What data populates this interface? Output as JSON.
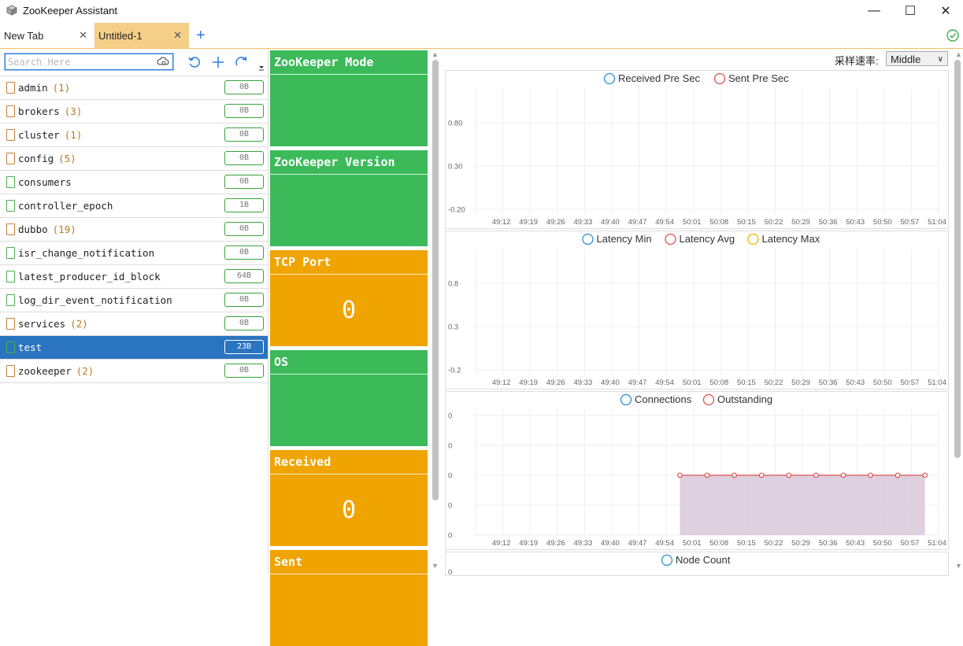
{
  "window": {
    "title": "ZooKeeper Assistant",
    "min": "—",
    "max": "☐",
    "close": "✕"
  },
  "tabs": [
    {
      "label": "New Tab",
      "close": "✕"
    },
    {
      "label": "Untitled-1",
      "close": "✕"
    }
  ],
  "tab_add": "+",
  "search": {
    "placeholder": "Search Here"
  },
  "nodes": [
    {
      "name": "admin",
      "count": "(1)",
      "size": "0B",
      "type": "folder"
    },
    {
      "name": "brokers",
      "count": "(3)",
      "size": "0B",
      "type": "folder"
    },
    {
      "name": "cluster",
      "count": "(1)",
      "size": "0B",
      "type": "folder"
    },
    {
      "name": "config",
      "count": "(5)",
      "size": "0B",
      "type": "folder"
    },
    {
      "name": "consumers",
      "count": "",
      "size": "0B",
      "type": "file"
    },
    {
      "name": "controller_epoch",
      "count": "",
      "size": "1B",
      "type": "file"
    },
    {
      "name": "dubbo",
      "count": "(19)",
      "size": "0B",
      "type": "folder"
    },
    {
      "name": "isr_change_notification",
      "count": "",
      "size": "0B",
      "type": "file"
    },
    {
      "name": "latest_producer_id_block",
      "count": "",
      "size": "64B",
      "type": "file"
    },
    {
      "name": "log_dir_event_notification",
      "count": "",
      "size": "0B",
      "type": "file"
    },
    {
      "name": "services",
      "count": "(2)",
      "size": "0B",
      "type": "folder"
    },
    {
      "name": "test",
      "count": "",
      "size": "23B",
      "type": "file",
      "selected": true
    },
    {
      "name": "zookeeper",
      "count": "(2)",
      "size": "0B",
      "type": "folder"
    }
  ],
  "cards": [
    {
      "title": "ZooKeeper Mode",
      "value": "",
      "color": "#3cba5a"
    },
    {
      "title": "ZooKeeper Version",
      "value": "",
      "color": "#3cba5a"
    },
    {
      "title": "TCP Port",
      "value": "0",
      "color": "#f0a400"
    },
    {
      "title": "OS",
      "value": "",
      "color": "#3cba5a"
    },
    {
      "title": "Received",
      "value": "0",
      "color": "#f0a400"
    },
    {
      "title": "Sent",
      "value": "",
      "color": "#f0a400"
    }
  ],
  "sample_rate": {
    "label": "采样速率:",
    "value": "Middle"
  },
  "chart_data": [
    {
      "type": "line",
      "series": [
        {
          "name": "Received Pre Sec",
          "color": "#2a8fd8",
          "values": []
        },
        {
          "name": "Sent Pre Sec",
          "color": "#e05050",
          "values": []
        }
      ],
      "x": [
        "49:12",
        "49:19",
        "49:26",
        "49:33",
        "49:40",
        "49:47",
        "49:54",
        "50:01",
        "50:08",
        "50:15",
        "50:22",
        "50:29",
        "50:36",
        "50:43",
        "50:50",
        "50:57",
        "51:04"
      ],
      "yticks": [
        "0.80",
        "0.30",
        "-0.20"
      ]
    },
    {
      "type": "line",
      "series": [
        {
          "name": "Latency Min",
          "color": "#2a8fd8",
          "values": []
        },
        {
          "name": "Latency Avg",
          "color": "#e05050",
          "values": []
        },
        {
          "name": "Latency Max",
          "color": "#f0b400",
          "values": []
        }
      ],
      "x": [
        "49:12",
        "49:19",
        "49:26",
        "49:33",
        "49:40",
        "49:47",
        "49:54",
        "50:01",
        "50:08",
        "50:15",
        "50:22",
        "50:29",
        "50:36",
        "50:43",
        "50:50",
        "50:57",
        "51:04"
      ],
      "yticks": [
        "0.8",
        "0.3",
        "-0.2"
      ]
    },
    {
      "type": "area",
      "series": [
        {
          "name": "Connections",
          "color": "#2a8fd8",
          "values": []
        },
        {
          "name": "Outstanding",
          "color": "#e05050",
          "values": [
            0,
            0,
            0,
            0,
            0,
            0,
            0,
            0,
            0,
            0
          ]
        }
      ],
      "x": [
        "49:12",
        "49:19",
        "49:26",
        "49:33",
        "49:40",
        "49:47",
        "49:54",
        "50:01",
        "50:08",
        "50:15",
        "50:22",
        "50:29",
        "50:36",
        "50:43",
        "50:50",
        "50:57",
        "51:04"
      ],
      "yticks": [
        "0",
        "0",
        "0",
        "0",
        "0"
      ]
    },
    {
      "type": "line",
      "series": [
        {
          "name": "Node Count",
          "color": "#2a8fd8",
          "values": []
        }
      ],
      "yticks": [
        "0"
      ]
    }
  ]
}
